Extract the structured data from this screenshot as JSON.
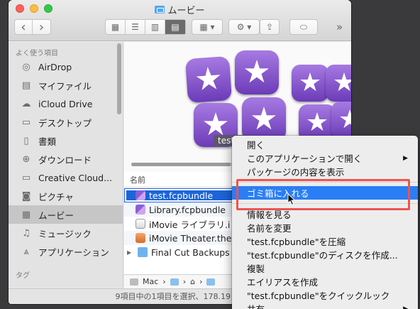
{
  "window": {
    "title": "ムービー"
  },
  "toolbar": {
    "back": "‹",
    "forward": "›",
    "more": "»"
  },
  "sidebar": {
    "section_favorites": "よく使う項目",
    "items": [
      {
        "label": "AirDrop",
        "icon": "airdrop-icon"
      },
      {
        "label": "マイファイル",
        "icon": "all-files-icon"
      },
      {
        "label": "iCloud Drive",
        "icon": "cloud-icon"
      },
      {
        "label": "デスクトップ",
        "icon": "desktop-icon"
      },
      {
        "label": "書類",
        "icon": "document-icon"
      },
      {
        "label": "ダウンロード",
        "icon": "download-icon"
      },
      {
        "label": "Creative Cloud...",
        "icon": "folder-icon"
      },
      {
        "label": "ピクチャ",
        "icon": "camera-icon"
      },
      {
        "label": "ムービー",
        "icon": "film-icon",
        "selected": true
      },
      {
        "label": "ミュージック",
        "icon": "music-icon"
      },
      {
        "label": "アプリケーション",
        "icon": "applications-icon"
      }
    ],
    "section_tags": "タグ"
  },
  "preview": {
    "label": "test.fc"
  },
  "list": {
    "column_name": "名前",
    "rows": [
      {
        "name": "test.fcpbundle",
        "icon": "fcpbundle-icon",
        "selected": true
      },
      {
        "name": "Library.fcpbundle",
        "icon": "fcpbundle-icon"
      },
      {
        "name": "iMovie ライブラリ.i",
        "icon": "imovie-library-icon"
      },
      {
        "name": "iMovie Theater.the",
        "icon": "imovie-theater-icon"
      },
      {
        "name": "Final Cut Backups",
        "icon": "folder-icon",
        "disclosure": true
      }
    ]
  },
  "pathbar": {
    "first": "Mac"
  },
  "status": {
    "text": "9項目中の1項目を選択、178.19 GB"
  },
  "context_menu": {
    "group1": [
      {
        "label": "開く"
      },
      {
        "label": "このアプリケーションで開く",
        "submenu": true
      },
      {
        "label": "パッケージの内容を表示"
      }
    ],
    "group2": [
      {
        "label": "ゴミ箱に入れる",
        "highlighted": true
      }
    ],
    "group3": [
      {
        "label": "情報を見る"
      },
      {
        "label": "名前を変更"
      },
      {
        "label": "\"test.fcpbundle\"を圧縮"
      },
      {
        "label": "\"test.fcpbundle\"のディスクを作成..."
      },
      {
        "label": "複製"
      },
      {
        "label": "エイリアスを作成"
      },
      {
        "label": "\"test.fcpbundle\"をクイックルック"
      },
      {
        "label": "共有",
        "submenu": true
      }
    ]
  },
  "colors": {
    "selection": "#1d64d8",
    "menu_highlight": "#2a7ef5",
    "annotation": "#ef5350"
  }
}
